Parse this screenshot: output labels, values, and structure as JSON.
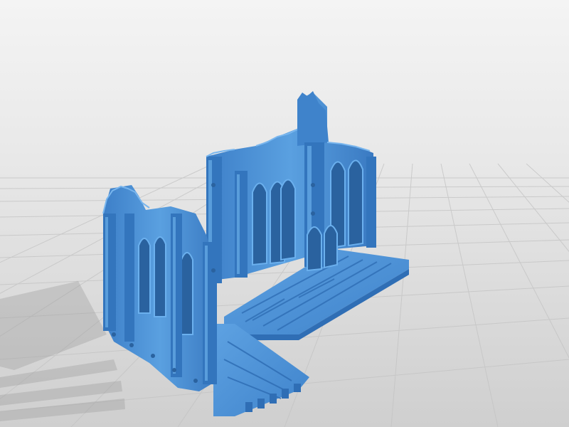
{
  "scene": {
    "model_color": "#4a90d9",
    "model_shadow_color": "#2f6eb5",
    "model_highlight_color": "#79b6ee",
    "grid_color": "#c9c9c9",
    "background_top_color": "#f2f2f2",
    "background_bottom_color": "#d2d2d2"
  }
}
